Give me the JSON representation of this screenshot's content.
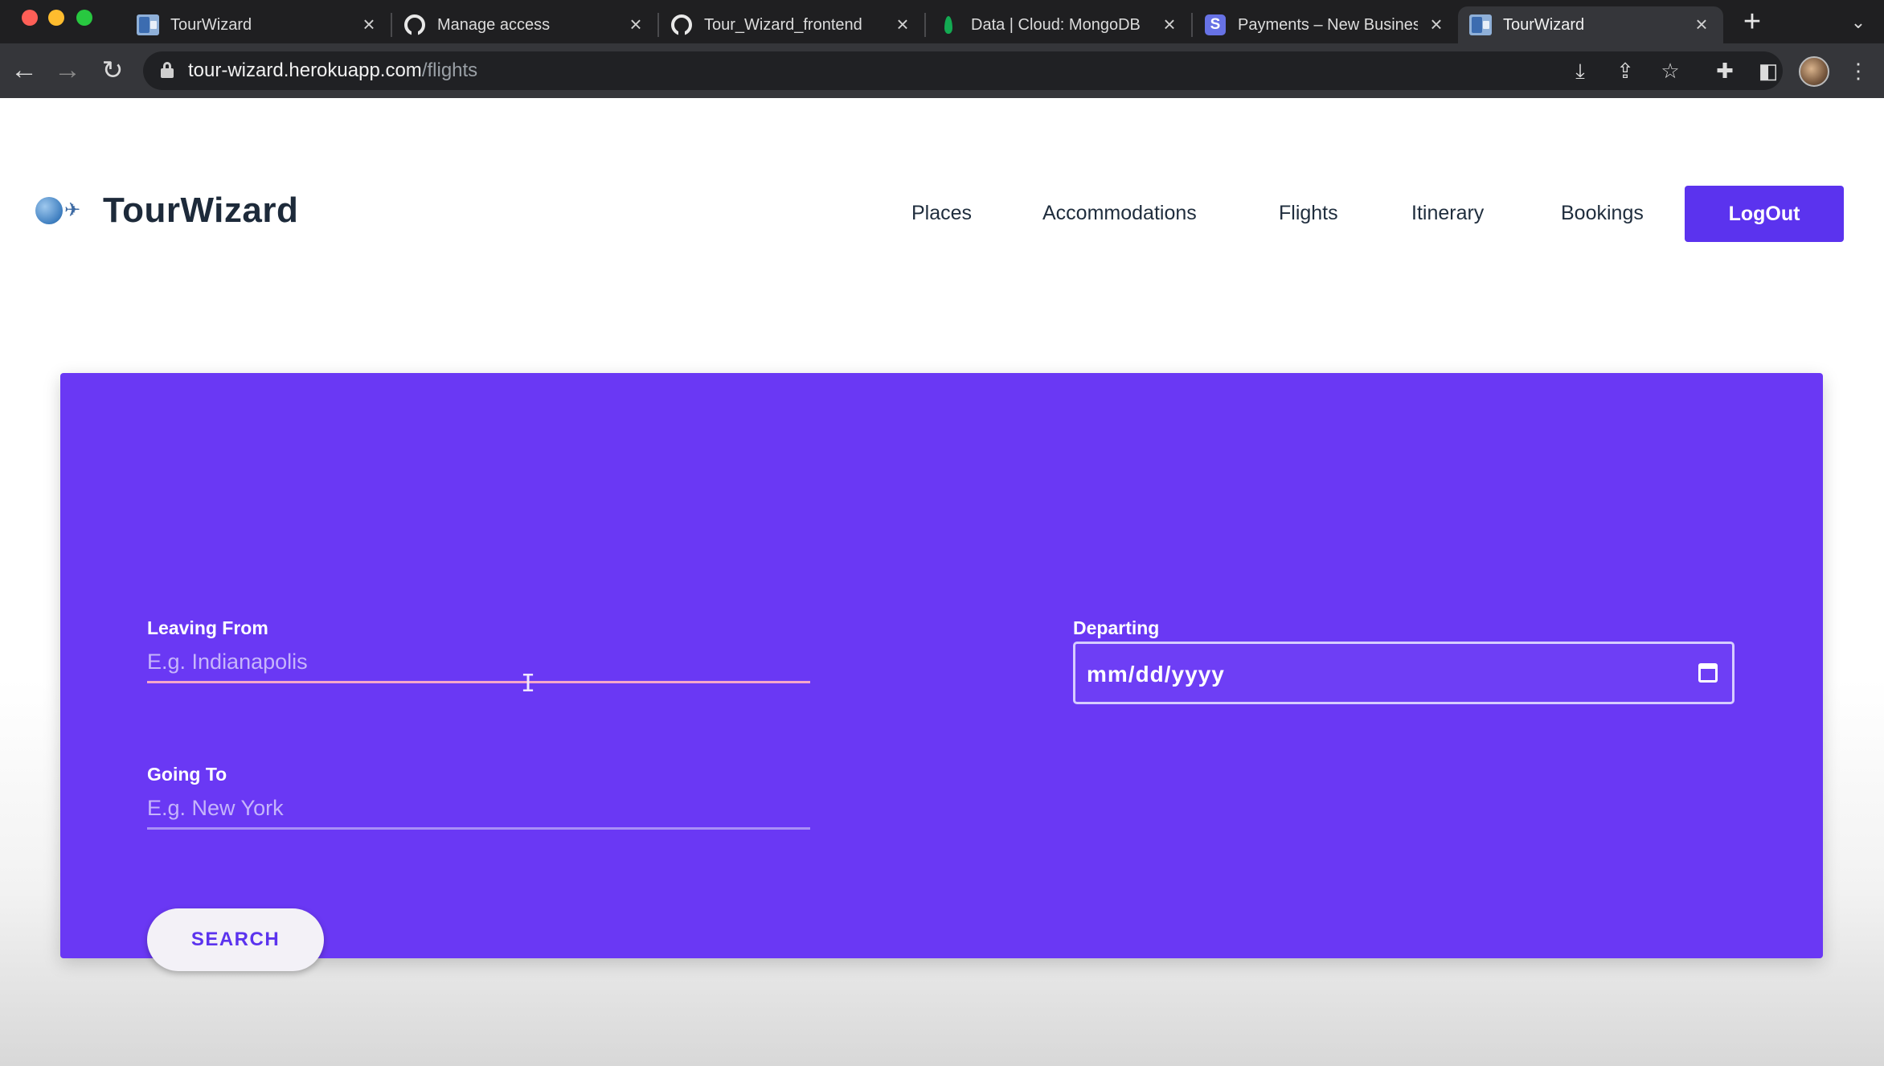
{
  "browser": {
    "tabs": [
      {
        "title": "TourWizard",
        "favicon": "tourwizard-favicon"
      },
      {
        "title": "Manage access",
        "favicon": "github-favicon"
      },
      {
        "title": "Tour_Wizard_frontend",
        "favicon": "github-favicon"
      },
      {
        "title": "Data | Cloud: MongoDB",
        "favicon": "mongodb-favicon"
      },
      {
        "title": "Payments – New Business",
        "favicon": "stripe-favicon"
      },
      {
        "title": "TourWizard",
        "favicon": "tourwizard-favicon",
        "active": true
      }
    ],
    "close_glyph": "×",
    "new_tab_glyph": "+",
    "stripe_letter": "S",
    "url_host": "tour-wizard.herokuapp.com",
    "url_path": "/flights"
  },
  "site": {
    "brand": "TourWizard",
    "nav": [
      "Places",
      "Accommodations",
      "Flights",
      "Itinerary",
      "Bookings"
    ],
    "logout_label": "LogOut",
    "accent_color": "#5b33ee",
    "panel_color": "#6a38f4"
  },
  "search_form": {
    "leaving_from_label": "Leaving From",
    "leaving_from_placeholder": "E.g. Indianapolis",
    "going_to_label": "Going To",
    "going_to_placeholder": "E.g. New York",
    "departing_label": "Departing",
    "departing_placeholder": "mm/dd/yyyy",
    "search_label": "SEARCH"
  }
}
